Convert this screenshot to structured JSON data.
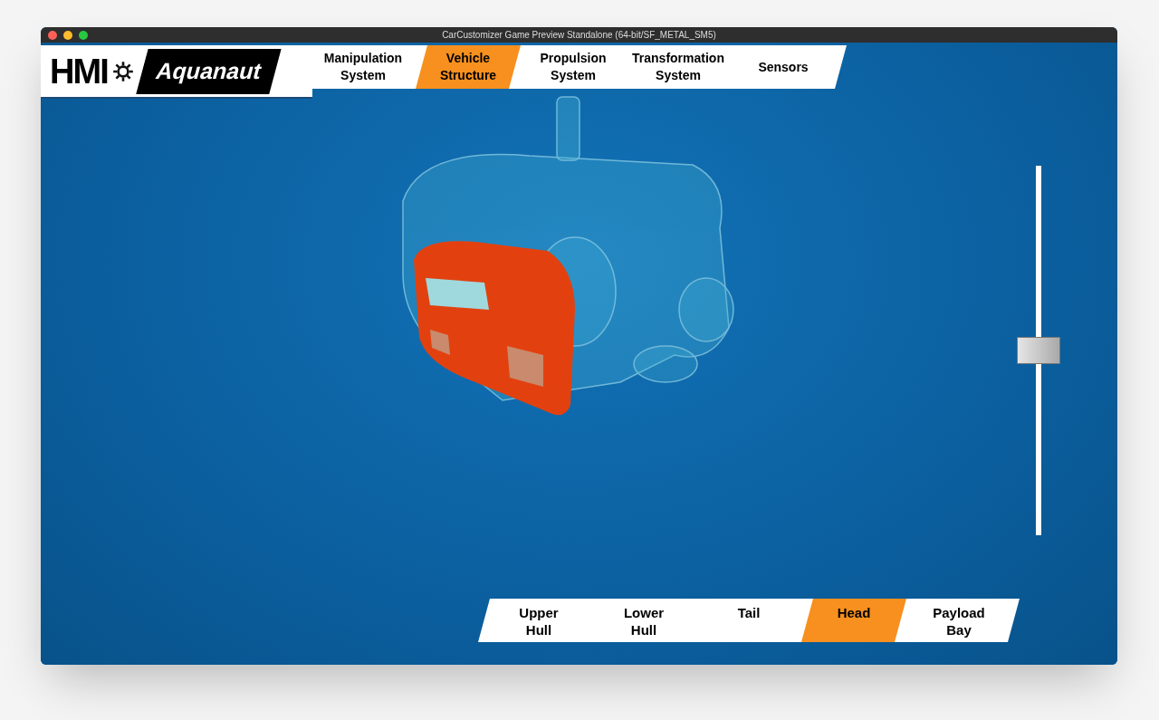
{
  "window": {
    "title": "CarCustomizer Game Preview Standalone (64-bit/SF_METAL_SM5)"
  },
  "logo": {
    "mark": "HMI",
    "name": "Aquanaut"
  },
  "top_tabs": [
    {
      "label": "Manipulation System",
      "selected": false
    },
    {
      "label": "Vehicle Structure",
      "selected": true
    },
    {
      "label": "Propulsion System",
      "selected": false
    },
    {
      "label": "Transformation System",
      "selected": false
    },
    {
      "label": "Sensors",
      "selected": false
    }
  ],
  "slider": {
    "level": 0.5
  },
  "part_tabs": [
    {
      "label": "Upper Hull",
      "selected": false
    },
    {
      "label": "Lower Hull",
      "selected": false
    },
    {
      "label": "Tail",
      "selected": false
    },
    {
      "label": "Head",
      "selected": true
    },
    {
      "label": "Payload Bay",
      "selected": false
    }
  ]
}
